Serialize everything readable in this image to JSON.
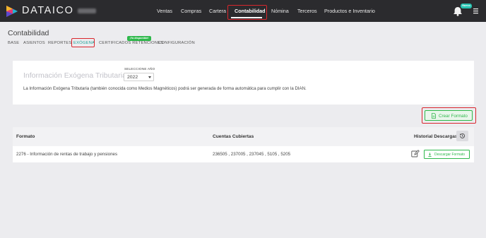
{
  "app": {
    "brand": "DATAICO",
    "badge_new": "Nuevo"
  },
  "nav": {
    "items": [
      {
        "label": "Ventas"
      },
      {
        "label": "Compras"
      },
      {
        "label": "Cartera"
      },
      {
        "label": "Contabilidad",
        "active": true
      },
      {
        "label": "Nómina"
      },
      {
        "label": "Terceros"
      },
      {
        "label": "Productos e Inventario"
      }
    ]
  },
  "page": {
    "title": "Contabilidad",
    "subtabs": [
      {
        "label": "BASE"
      },
      {
        "label": "ASIENTOS"
      },
      {
        "label": "REPORTES"
      },
      {
        "label": "EXÓGENA",
        "active": true
      },
      {
        "label": "CERTIFICADOS RETENCIONES"
      },
      {
        "label": "CONFIGURACIÓN"
      }
    ],
    "available_badge": "¡Ya disponible!"
  },
  "info": {
    "heading": "Información Exógena Tributaria",
    "year_label": "SELECCIONE AÑO",
    "year_value": "2022",
    "description": "La Información Exógena Tributaria (también conocida como Medios Magnéticos) podrá ser generada de forma automática para cumplir con la DIAN."
  },
  "actions": {
    "create_label": "Crear Formato"
  },
  "table": {
    "headers": {
      "formato": "Formato",
      "cuentas": "Cuentas Cubiertas",
      "historial": "Historial Descargas"
    },
    "rows": [
      {
        "formato": "2276 - Información de rentas de trabajo y pensiones",
        "cuentas": "236505 , 237005 , 237045 , 5105 , 5205",
        "download_label": "Descargar Formato"
      }
    ]
  },
  "colors": {
    "accent_teal": "#20a39a",
    "success_green": "#2eb84b",
    "highlight_red": "#d9262d",
    "topbar": "#2b2b2e"
  }
}
